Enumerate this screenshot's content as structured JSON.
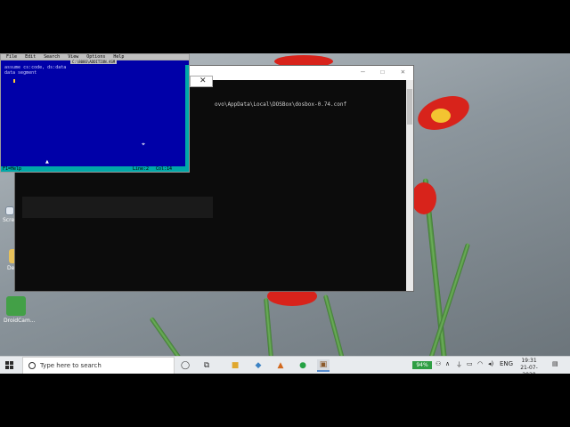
{
  "editor": {
    "menu": [
      "File",
      "Edit",
      "Search",
      "View",
      "Options",
      "Help"
    ],
    "filename": "C:\\8086\\ADDITION.ASM",
    "lines": [
      "assume cs:code, ds:data",
      "data segment"
    ],
    "status_help": "F1=Help",
    "status_line": "Line:2",
    "status_col": "Col:14"
  },
  "console": {
    "path_text": "ovo\\AppData\\Local\\DOSBox\\dosbox-0.74.conf",
    "minimize": "—",
    "maximize": "☐",
    "close": "✕"
  },
  "dosbox": {
    "close": "✕"
  },
  "desktop_icons": [
    {
      "label": "Fi"
    },
    {
      "label": "Scre"
    },
    {
      "label": "De"
    },
    {
      "label": "DroidCam..."
    }
  ],
  "taskbar": {
    "search_placeholder": "Type here to search",
    "battery": "94%",
    "language": "ENG",
    "time": "19:31",
    "date": "21-07-2020"
  },
  "colors": {
    "dos_blue": "#0000a8",
    "dos_cyan": "#00a8a8",
    "battery_green": "#2f9e44"
  }
}
